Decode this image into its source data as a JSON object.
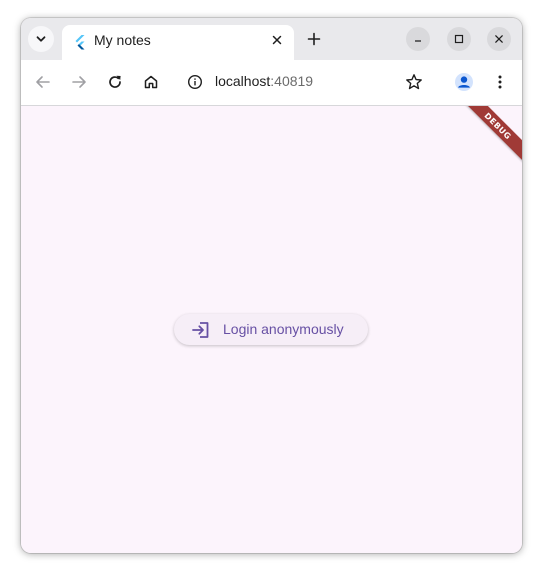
{
  "browser": {
    "tab": {
      "title": "My notes",
      "favicon": "flutter-logo-icon"
    },
    "controls": {
      "tab_search": "chevron-down-icon",
      "tab_close": "close-icon",
      "new_tab": "plus-icon",
      "minimize": "minimize-icon",
      "maximize": "maximize-icon",
      "close": "close-icon"
    },
    "toolbar": {
      "back": "arrow-left-icon",
      "forward": "arrow-right-icon",
      "reload": "reload-icon",
      "home": "home-icon",
      "site_info": "info-icon",
      "bookmark": "star-icon",
      "profile": "profile-icon",
      "menu": "more-vert-icon"
    },
    "address": {
      "host": "localhost",
      "port": ":40819"
    }
  },
  "page": {
    "debug_banner": "DEBUG",
    "login_button": {
      "label": "Login anonymously",
      "icon": "login-icon"
    },
    "colors": {
      "background": "#fcf4fc",
      "button_bg": "#f6eef7",
      "accent": "#6750a4",
      "debug_banner": "#a03a36"
    }
  }
}
